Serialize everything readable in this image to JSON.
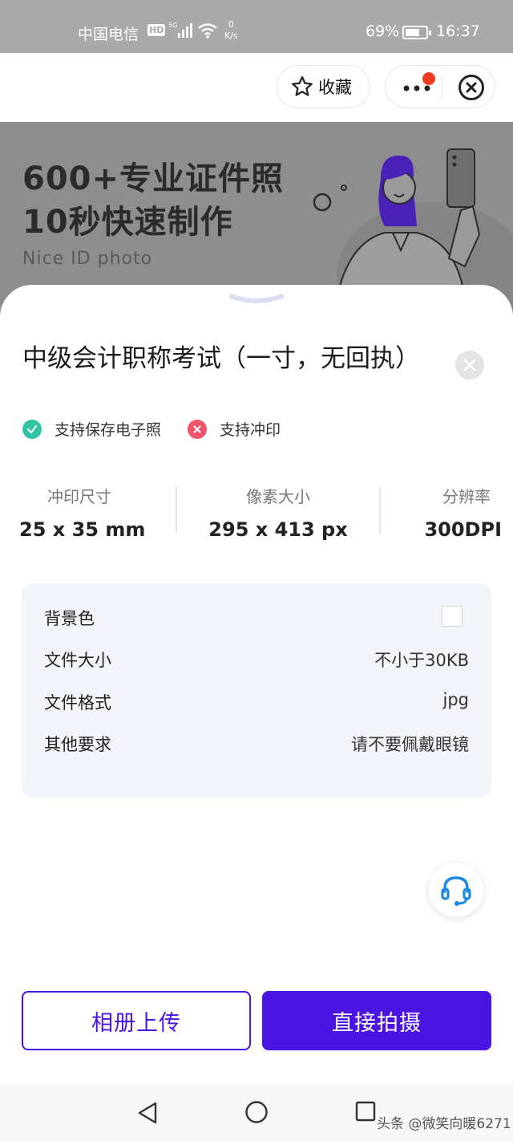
{
  "status_bar": {
    "carrier": "中国电信",
    "hd_badge": "HD",
    "net_speed_value": "0",
    "net_speed_unit": "K/s",
    "battery_percent": "69%",
    "battery_level": 0.69,
    "time": "16:37"
  },
  "top_nav": {
    "favorite_label": "收藏",
    "has_notification_dot": true
  },
  "banner": {
    "line1": "600+专业证件照",
    "line2": "10秒快速制作",
    "subtitle": "Nice ID photo"
  },
  "sheet": {
    "title": "中级会计职称考试（一寸，无回执）",
    "support": [
      {
        "label": "支持保存电子照",
        "status": "yes",
        "color": "#2fc4a2"
      },
      {
        "label": "支持冲印",
        "status": "no",
        "color": "#f0546b"
      }
    ],
    "specs": [
      {
        "label": "冲印尺寸",
        "value": "25 x 35 mm"
      },
      {
        "label": "像素大小",
        "value": "295 x 413 px"
      },
      {
        "label": "分辨率",
        "value": "300DPI"
      }
    ],
    "requirements": {
      "background_label": "背景色",
      "background_color": "#ffffff",
      "file_size_label": "文件大小",
      "file_size_value": "不小于30KB",
      "format_label": "文件格式",
      "format_value": "jpg",
      "other_label": "其他要求",
      "other_value": "请不要佩戴眼镜"
    },
    "buttons": {
      "upload": "相册上传",
      "shoot": "直接拍摄"
    }
  },
  "colors": {
    "accent": "#4a14e3",
    "green": "#2fc4a2",
    "red": "#f0546b",
    "notification_dot": "#f23a20"
  },
  "watermark": "头条 @微笑向暖6271"
}
